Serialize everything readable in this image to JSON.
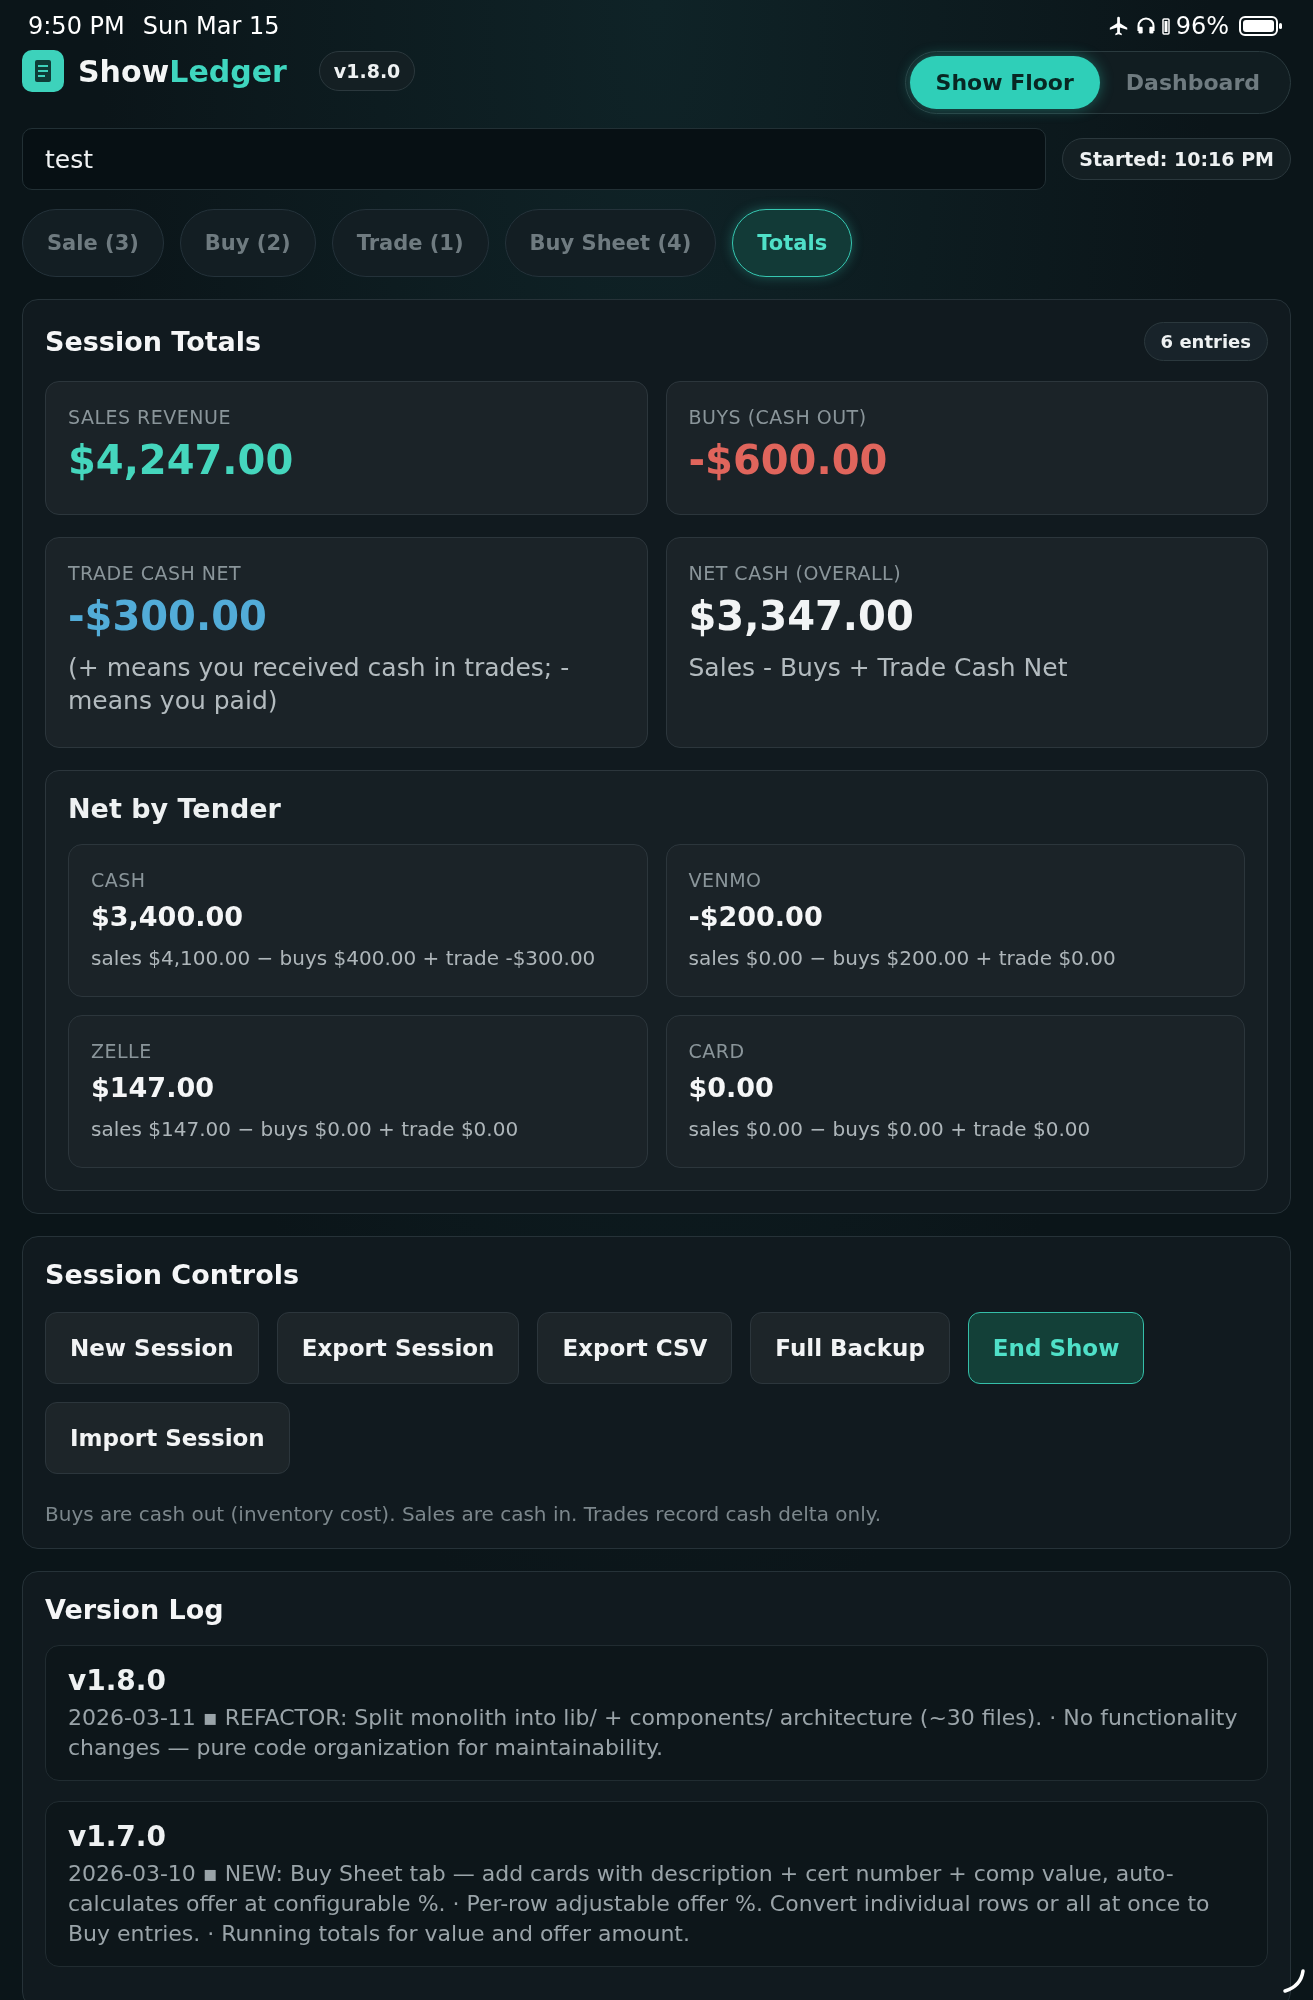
{
  "status_bar": {
    "time": "9:50 PM",
    "date": "Sun Mar 15",
    "battery_text": "96%"
  },
  "header": {
    "brand_part_1": "Show",
    "brand_part_2": "Ledger",
    "version": "v1.8.0",
    "views": [
      {
        "label": "Show Floor",
        "selected": true
      },
      {
        "label": "Dashboard",
        "selected": false
      }
    ]
  },
  "session_name": {
    "value": "test"
  },
  "started": "Started: 10:16 PM",
  "tabs": [
    {
      "label": "Sale (3)",
      "selected": false
    },
    {
      "label": "Buy (2)",
      "selected": false
    },
    {
      "label": "Trade (1)",
      "selected": false
    },
    {
      "label": "Buy Sheet (4)",
      "selected": false
    },
    {
      "label": "Totals",
      "selected": true
    }
  ],
  "session_totals": {
    "title": "Session Totals",
    "badge": "6 entries",
    "stats": [
      {
        "label": "SALES REVENUE",
        "value": "$4,247.00",
        "color": "#45d6bd"
      },
      {
        "label": "BUYS (CASH OUT)",
        "value": "-$600.00",
        "color": "#e0655c"
      },
      {
        "label": "TRADE CASH NET",
        "value": "-$300.00",
        "color": "#52acd8",
        "note": "(+ means you received cash in trades; - means you paid)"
      },
      {
        "label": "NET CASH (OVERALL)",
        "value": "$3,347.00",
        "color": "#f2f4f5",
        "note": "Sales - Buys + Trade Cash Net"
      }
    ],
    "tender": {
      "title": "Net by Tender",
      "items": [
        {
          "label": "CASH",
          "value": "$3,400.00",
          "detail": "sales $4,100.00 − buys $400.00 + trade -$300.00"
        },
        {
          "label": "VENMO",
          "value": "-$200.00",
          "detail": "sales $0.00 − buys $200.00 + trade $0.00"
        },
        {
          "label": "ZELLE",
          "value": "$147.00",
          "detail": "sales $147.00 − buys $0.00 + trade $0.00"
        },
        {
          "label": "CARD",
          "value": "$0.00",
          "detail": "sales $0.00 − buys $0.00 + trade $0.00"
        }
      ]
    }
  },
  "session_controls": {
    "title": "Session Controls",
    "buttons": [
      {
        "label": "New Session",
        "kind": "normal"
      },
      {
        "label": "Export Session",
        "kind": "normal"
      },
      {
        "label": "Export CSV",
        "kind": "normal"
      },
      {
        "label": "Full Backup",
        "kind": "normal"
      },
      {
        "label": "End Show",
        "kind": "accent"
      },
      {
        "label": "Import Session",
        "kind": "normal"
      }
    ],
    "note": "Buys are cash out (inventory cost). Sales are cash in. Trades record cash delta only."
  },
  "version_log": {
    "title": "Version Log",
    "entries": [
      {
        "version": "v1.8.0",
        "text": "2026-03-11 ▪ REFACTOR: Split monolith into lib/ + components/ architecture (~30 files). · No functionality changes — pure code organization for maintainability."
      },
      {
        "version": "v1.7.0",
        "text": "2026-03-10 ▪ NEW: Buy Sheet tab — add cards with description + cert number + comp value, auto-calculates offer at configurable %. · Per-row adjustable offer %. Convert individual rows or all at once to Buy entries. · Running totals for value and offer amount."
      }
    ]
  }
}
